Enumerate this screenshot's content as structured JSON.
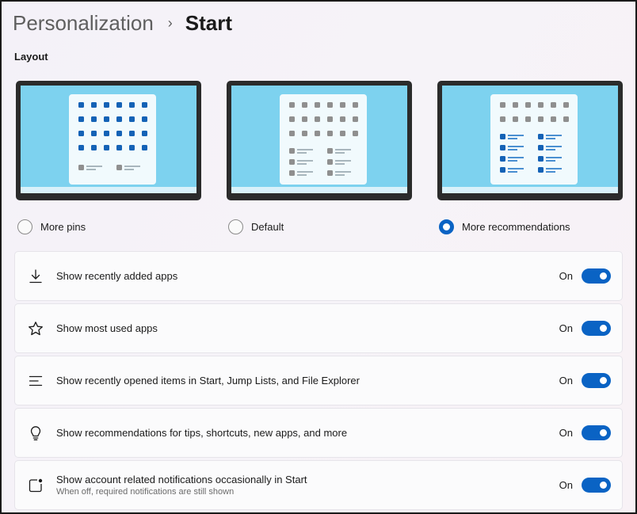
{
  "breadcrumb": {
    "parent": "Personalization",
    "separator": "›",
    "current": "Start"
  },
  "layout": {
    "title": "Layout",
    "options": [
      {
        "label": "More pins",
        "selected": false
      },
      {
        "label": "Default",
        "selected": false
      },
      {
        "label": "More recommendations",
        "selected": true
      }
    ]
  },
  "settings": [
    {
      "label": "Show recently added apps",
      "state": "On",
      "enabled": true,
      "icon": "download-icon"
    },
    {
      "label": "Show most used apps",
      "state": "On",
      "enabled": true,
      "icon": "star-icon"
    },
    {
      "label": "Show recently opened items in Start, Jump Lists, and File Explorer",
      "state": "On",
      "enabled": true,
      "icon": "list-icon"
    },
    {
      "label": "Show recommendations for tips, shortcuts, new apps, and more",
      "state": "On",
      "enabled": true,
      "icon": "lightbulb-icon"
    },
    {
      "label": "Show account related notifications occasionally in Start",
      "sublabel": "When off, required notifications are still shown",
      "state": "On",
      "enabled": true,
      "icon": "notification-icon"
    }
  ],
  "colors": {
    "accent": "#0a63c4",
    "screen": "#7dd2ef",
    "monitor_frame": "#2b2b2b"
  }
}
